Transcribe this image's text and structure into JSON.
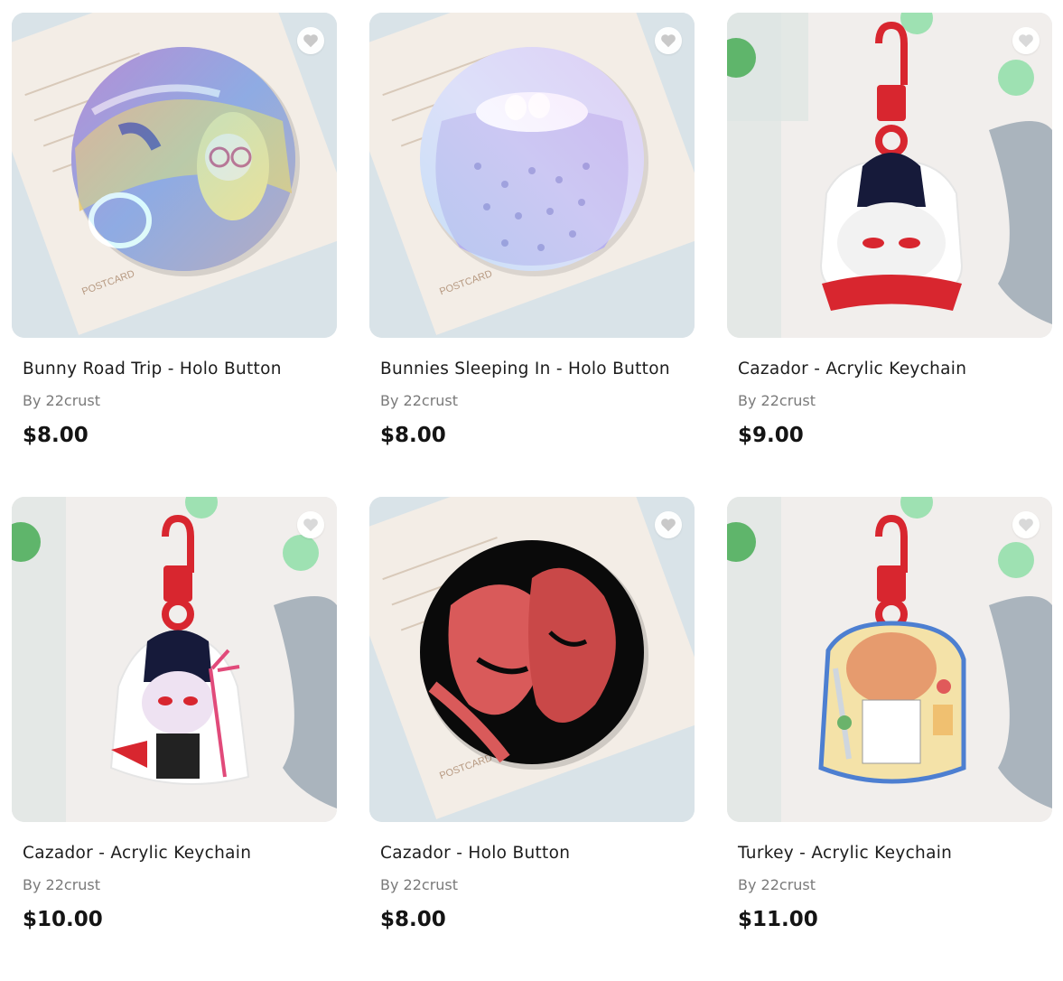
{
  "products": [
    {
      "title": "Bunny Road Trip - Holo Button",
      "by": "By 22crust",
      "price": "$8.00",
      "image_icon": "holo-button-bunny-road-trip-image"
    },
    {
      "title": "Bunnies Sleeping In - Holo Button",
      "by": "By 22crust",
      "price": "$8.00",
      "image_icon": "holo-button-bunnies-sleeping-image"
    },
    {
      "title": "Cazador - Acrylic Keychain",
      "by": "By 22crust",
      "price": "$9.00",
      "image_icon": "acrylic-keychain-cazador-image"
    },
    {
      "title": "Cazador - Acrylic Keychain",
      "by": "By 22crust",
      "price": "$10.00",
      "image_icon": "acrylic-keychain-cazador-devil-image"
    },
    {
      "title": "Cazador - Holo Button",
      "by": "By 22crust",
      "price": "$8.00",
      "image_icon": "holo-button-cazador-kiss-image"
    },
    {
      "title": "Turkey - Acrylic Keychain",
      "by": "By 22crust",
      "price": "$11.00",
      "image_icon": "acrylic-keychain-turkey-image"
    }
  ],
  "favorite_icon": "heart-icon",
  "postcard_text": "POSTCARD",
  "colors": {
    "price": "#141414",
    "by_text": "#7a7a7a",
    "keychain_clip": "#d8262f",
    "button_bg_card": "#dfe6ea"
  }
}
